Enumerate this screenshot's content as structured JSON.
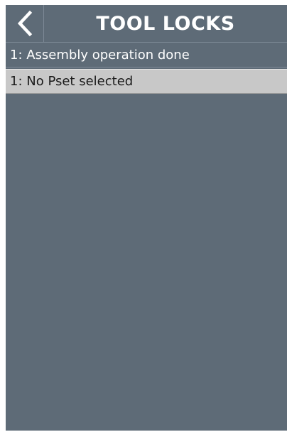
{
  "header": {
    "title": "TOOL LOCKS",
    "back_icon": "chevron-left-icon"
  },
  "locks": [
    {
      "label": "1: Assembly operation done",
      "selected": false
    },
    {
      "label": "1: No Pset selected",
      "selected": true
    }
  ],
  "colors": {
    "background": "#5e6b77",
    "divider": "#7d8996",
    "selected_row": "#c8c8c8",
    "text_light": "#ffffff",
    "text_dark": "#1a1a1a"
  }
}
